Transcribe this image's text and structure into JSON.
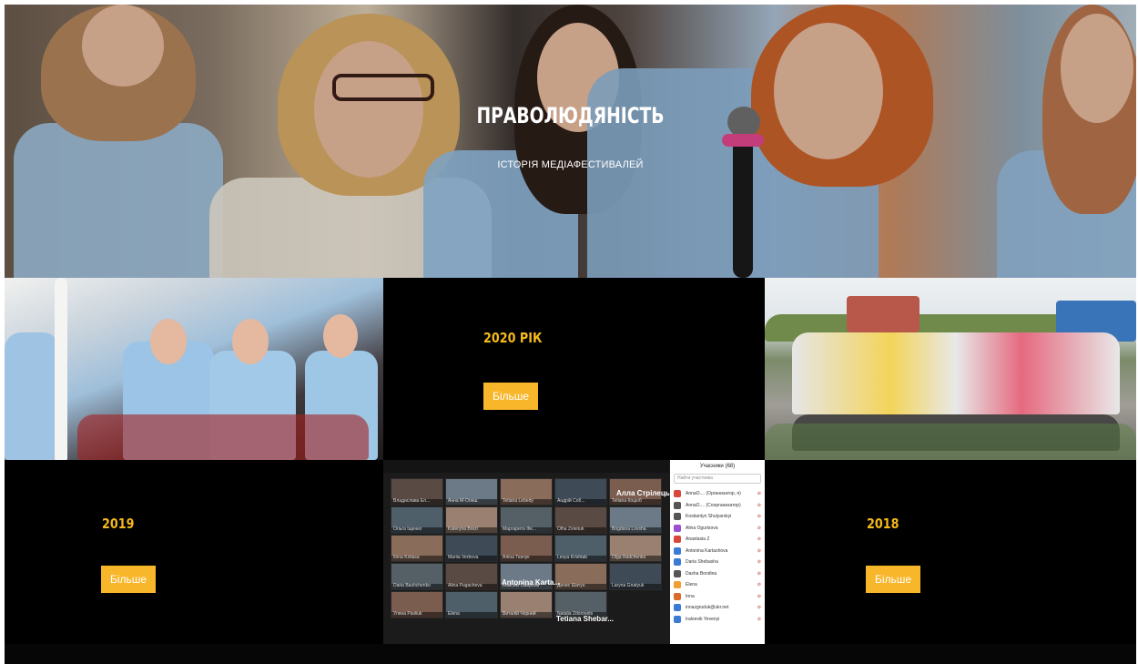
{
  "hero": {
    "title": "ПРАВОЛЮДЯНІСТЬ",
    "subtitle": "ІСТОРІЯ МЕДІАФЕСТИВАЛЕЙ"
  },
  "sections": [
    {
      "year": "2020 РІК",
      "button": "Більше"
    },
    {
      "year": "2019",
      "button": "Більше"
    },
    {
      "year": "2018",
      "button": "Більше"
    }
  ],
  "zoom": {
    "participants_header": "Учасники (68)",
    "search_placeholder": "Найти участника",
    "big_names": [
      "Алла Стрілець",
      "Antonina Karta...",
      "Tetiana Shebar..."
    ],
    "tile_names": [
      "Владислава Ел...",
      "Анна М-Олеш.",
      "Tetiana Lebedy",
      "Андрій Соб...",
      "Tetiana Коцюб",
      "Ольга Іщенко",
      "Kateryna Brezl",
      "Маргарита Фе...",
      "Olha Zvieriuk",
      "Bogdana Lovsha",
      "Ilona Koliasa",
      "Mariia Verbova",
      "Аліна Ткачук",
      "Lesya Krishtab",
      "Olga Radchenko",
      "Daria Bashchenko",
      "Alina Pugacheva",
      "Максим Смирнов",
      "Денис Шатун",
      "Laryna Gnatyuk",
      "Уляна Pavliuk",
      "Elena",
      "Виталій Чорний",
      "Natalia Zdorovets"
    ],
    "participants": [
      {
        "name": "AnnaO.... (Организатор, я)",
        "color": "#d9463a"
      },
      {
        "name": "AnnaO.... (Соорганизатор)",
        "color": "#555555"
      },
      {
        "name": "Kostiantyn Shulyarskyi",
        "color": "#555555"
      },
      {
        "name": "Alina Ogurtsova",
        "color": "#9b4fd1"
      },
      {
        "name": "Anastasia Z",
        "color": "#d9463a"
      },
      {
        "name": "Antonina Kartashova",
        "color": "#3a7bd5"
      },
      {
        "name": "Daria Shebasha",
        "color": "#3a7bd5"
      },
      {
        "name": "Dasha Bondina",
        "color": "#555555"
      },
      {
        "name": "Elena",
        "color": "#f0a030"
      },
      {
        "name": "Inna",
        "color": "#d96a2a"
      },
      {
        "name": "innazgruduk@ukr.net",
        "color": "#3a7bd5"
      },
      {
        "name": "Iraleevik Yevenyi",
        "color": "#3a7bd5"
      }
    ]
  },
  "colors": {
    "accent": "#f8b62a",
    "year_text": "#f5b91c",
    "tile_bg": "#000000"
  }
}
